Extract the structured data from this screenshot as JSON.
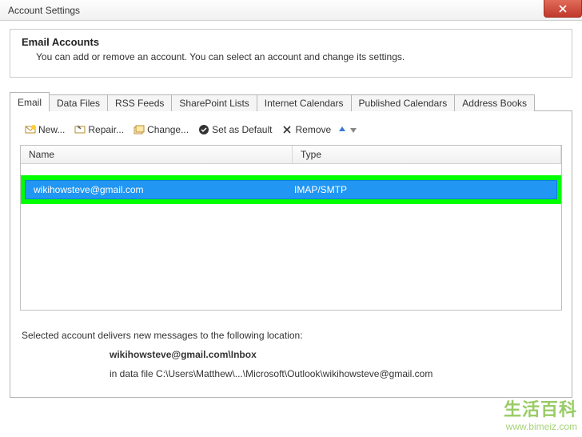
{
  "window": {
    "title": "Account Settings"
  },
  "section": {
    "title": "Email Accounts",
    "desc": "You can add or remove an account. You can select an account and change its settings."
  },
  "tabs": [
    {
      "label": "Email",
      "active": true
    },
    {
      "label": "Data Files",
      "active": false
    },
    {
      "label": "RSS Feeds",
      "active": false
    },
    {
      "label": "SharePoint Lists",
      "active": false
    },
    {
      "label": "Internet Calendars",
      "active": false
    },
    {
      "label": "Published Calendars",
      "active": false
    },
    {
      "label": "Address Books",
      "active": false
    }
  ],
  "toolbar": {
    "new": "New...",
    "repair": "Repair...",
    "change": "Change...",
    "set_default": "Set as Default",
    "remove": "Remove"
  },
  "list": {
    "headers": {
      "name": "Name",
      "type": "Type"
    },
    "rows": [
      {
        "name": "wikihowsteve@gmail.com",
        "type": "IMAP/SMTP",
        "selected": true
      }
    ]
  },
  "footer": {
    "line1": "Selected account delivers new messages to the following location:",
    "account_path": "wikihowsteve@gmail.com\\Inbox",
    "data_file_prefix": "in data file ",
    "data_file": "C:\\Users\\Matthew\\...\\Microsoft\\Outlook\\wikihowsteve@gmail.com"
  },
  "watermark": {
    "cn": "生活百科",
    "url": "www.bimeiz.com"
  }
}
